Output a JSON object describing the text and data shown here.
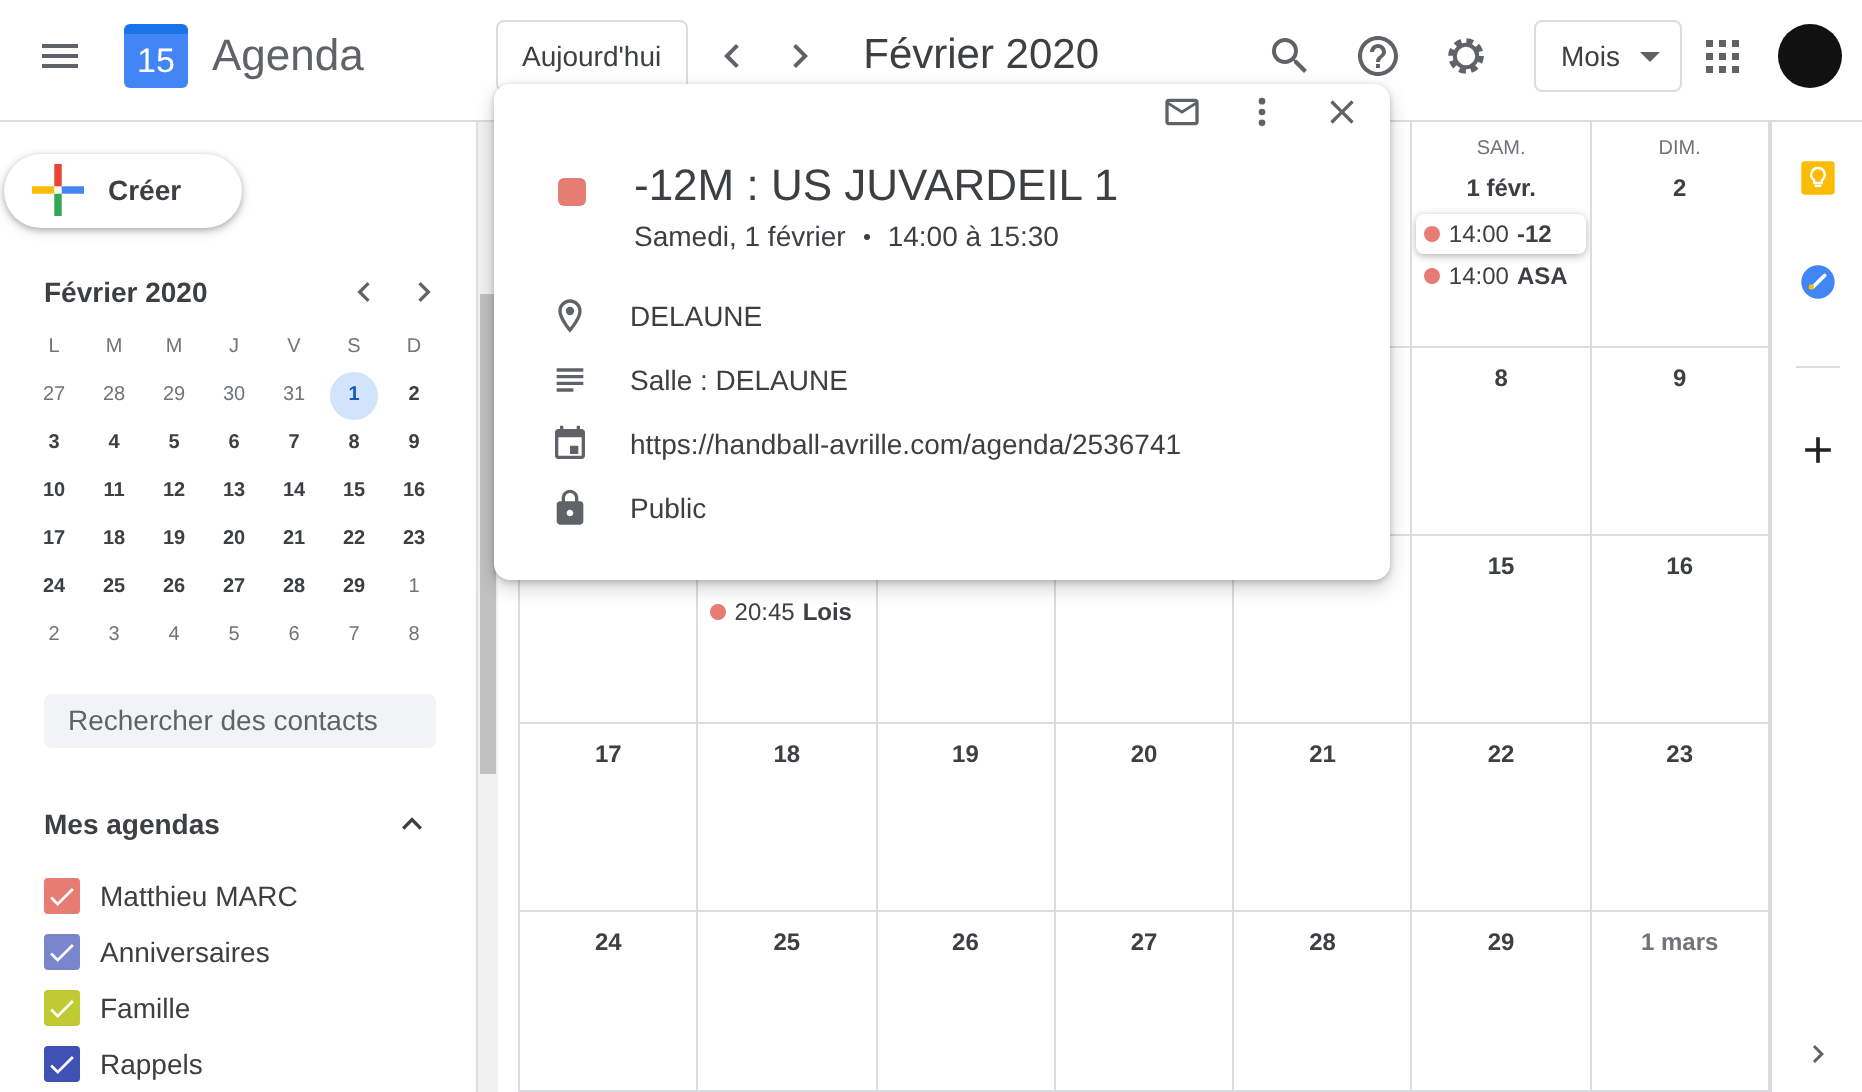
{
  "header": {
    "logo_text": "15",
    "app_name": "Agenda",
    "today_button": "Aujourd'hui",
    "title": "Février 2020",
    "view_select": "Mois"
  },
  "sidebar": {
    "create_button": "Créer",
    "mini_calendar": {
      "title": "Février 2020",
      "weekdays": [
        "L",
        "M",
        "M",
        "J",
        "V",
        "S",
        "D"
      ],
      "days": [
        {
          "text": "27",
          "muted": true,
          "selected": false
        },
        {
          "text": "28",
          "muted": true,
          "selected": false
        },
        {
          "text": "29",
          "muted": true,
          "selected": false
        },
        {
          "text": "30",
          "muted": true,
          "selected": false
        },
        {
          "text": "31",
          "muted": true,
          "selected": false
        },
        {
          "text": "1",
          "muted": false,
          "selected": true
        },
        {
          "text": "2",
          "muted": false,
          "selected": false
        },
        {
          "text": "3",
          "muted": false,
          "selected": false
        },
        {
          "text": "4",
          "muted": false,
          "selected": false
        },
        {
          "text": "5",
          "muted": false,
          "selected": false
        },
        {
          "text": "6",
          "muted": false,
          "selected": false
        },
        {
          "text": "7",
          "muted": false,
          "selected": false
        },
        {
          "text": "8",
          "muted": false,
          "selected": false
        },
        {
          "text": "9",
          "muted": false,
          "selected": false
        },
        {
          "text": "10",
          "muted": false,
          "selected": false
        },
        {
          "text": "11",
          "muted": false,
          "selected": false
        },
        {
          "text": "12",
          "muted": false,
          "selected": false
        },
        {
          "text": "13",
          "muted": false,
          "selected": false
        },
        {
          "text": "14",
          "muted": false,
          "selected": false
        },
        {
          "text": "15",
          "muted": false,
          "selected": false
        },
        {
          "text": "16",
          "muted": false,
          "selected": false
        },
        {
          "text": "17",
          "muted": false,
          "selected": false
        },
        {
          "text": "18",
          "muted": false,
          "selected": false
        },
        {
          "text": "19",
          "muted": false,
          "selected": false
        },
        {
          "text": "20",
          "muted": false,
          "selected": false
        },
        {
          "text": "21",
          "muted": false,
          "selected": false
        },
        {
          "text": "22",
          "muted": false,
          "selected": false
        },
        {
          "text": "23",
          "muted": false,
          "selected": false
        },
        {
          "text": "24",
          "muted": false,
          "selected": false
        },
        {
          "text": "25",
          "muted": false,
          "selected": false
        },
        {
          "text": "26",
          "muted": false,
          "selected": false
        },
        {
          "text": "27",
          "muted": false,
          "selected": false
        },
        {
          "text": "28",
          "muted": false,
          "selected": false
        },
        {
          "text": "29",
          "muted": false,
          "selected": false
        },
        {
          "text": "1",
          "muted": true,
          "selected": false
        },
        {
          "text": "2",
          "muted": true,
          "selected": false
        },
        {
          "text": "3",
          "muted": true,
          "selected": false
        },
        {
          "text": "4",
          "muted": true,
          "selected": false
        },
        {
          "text": "5",
          "muted": true,
          "selected": false
        },
        {
          "text": "6",
          "muted": true,
          "selected": false
        },
        {
          "text": "7",
          "muted": true,
          "selected": false
        },
        {
          "text": "8",
          "muted": true,
          "selected": false
        }
      ]
    },
    "contact_search": {
      "placeholder": "Rechercher des contacts"
    },
    "my_calendars": {
      "title": "Mes agendas",
      "expanded": true,
      "items": [
        {
          "name": "Matthieu MARC",
          "color": "#e67c73",
          "checked": true
        },
        {
          "name": "Anniversaires",
          "color": "#7986cb",
          "checked": true
        },
        {
          "name": "Famille",
          "color": "#c0ca33",
          "checked": true
        },
        {
          "name": "Rappels",
          "color": "#3f51b5",
          "checked": true
        }
      ]
    }
  },
  "month_grid": {
    "weeks": [
      [
        {
          "weekday": "SAM.",
          "date": "1 févr.",
          "muted": false,
          "events": [
            {
              "time": "14:00",
              "title": "-12",
              "color": "#e67c73",
              "selected": true
            },
            {
              "time": "14:00",
              "title": "ASA",
              "color": "#e67c73",
              "selected": false
            }
          ]
        },
        {
          "weekday": "DIM.",
          "date": "2",
          "muted": false
        }
      ],
      [
        {
          "date": "8",
          "muted": false
        },
        {
          "date": "9",
          "muted": false
        }
      ],
      [
        {
          "events": [
            {
              "time": "20:45",
              "title": "Lois",
              "color": "#e67c73",
              "selected": false
            }
          ]
        },
        {
          "date": "15",
          "muted": false
        },
        {
          "date": "16",
          "muted": false
        }
      ],
      [
        {
          "date": "17",
          "muted": false
        },
        {
          "date": "18",
          "muted": false
        },
        {
          "date": "19",
          "muted": false
        },
        {
          "date": "20",
          "muted": false
        },
        {
          "date": "21",
          "muted": false
        },
        {
          "date": "22",
          "muted": false
        },
        {
          "date": "23",
          "muted": false
        }
      ],
      [
        {
          "date": "24",
          "muted": false
        },
        {
          "date": "25",
          "muted": false
        },
        {
          "date": "26",
          "muted": false
        },
        {
          "date": "27",
          "muted": false
        },
        {
          "date": "28",
          "muted": false
        },
        {
          "date": "29",
          "muted": false
        },
        {
          "date": "1 mars",
          "muted": true
        }
      ]
    ]
  },
  "event_popup": {
    "title": "-12M : US JUVARDEIL 1",
    "date": "Samedi, 1 février",
    "time": "14:00 à 15:30",
    "details": [
      {
        "kind": "location",
        "text": "DELAUNE"
      },
      {
        "kind": "description",
        "text": "Salle : DELAUNE"
      },
      {
        "kind": "calendar",
        "text": "https://handball-avrille.com/agenda/2536741"
      },
      {
        "kind": "visibility",
        "text": "Public"
      }
    ]
  }
}
